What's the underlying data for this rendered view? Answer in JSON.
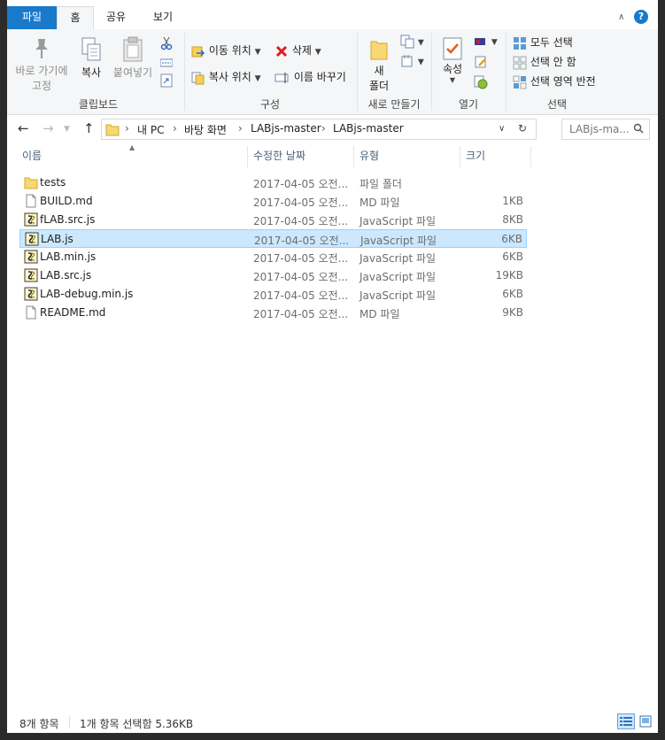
{
  "tabs": [
    {
      "label": "파일"
    },
    {
      "label": "홈"
    },
    {
      "label": "공유"
    },
    {
      "label": "보기"
    }
  ],
  "ribbon": {
    "clipboard": {
      "pin_label_1": "바로 가기에",
      "pin_label_2": "고정",
      "copy_label": "복사",
      "paste_label": "붙여넣기",
      "group_label": "클립보드"
    },
    "organize": {
      "move_label": "이동 위치",
      "copy_to_label": "복사 위치",
      "delete_label": "삭제",
      "rename_label": "이름 바꾸기",
      "group_label": "구성"
    },
    "new": {
      "new_folder_1": "새",
      "new_folder_2": "폴더",
      "group_label": "새로 만들기"
    },
    "open": {
      "properties_label": "속성",
      "group_label": "열기"
    },
    "select": {
      "select_all": "모두 선택",
      "select_none": "선택 안 함",
      "invert": "선택 영역 반전",
      "group_label": "선택"
    }
  },
  "address": {
    "crumbs": [
      "내 PC",
      "바탕 화면",
      "LABjs-master",
      "LABjs-master"
    ],
    "search_placeholder": "LABjs-ma..."
  },
  "columns": {
    "name": "이름",
    "date": "수정한 날짜",
    "type": "유형",
    "size": "크기"
  },
  "files": [
    {
      "name": "tests",
      "date": "2017-04-05 오전...",
      "type": "파일 폴더",
      "size": "",
      "icon": "folder-icon",
      "selected": false
    },
    {
      "name": "BUILD.md",
      "date": "2017-04-05 오전...",
      "type": "MD 파일",
      "size": "1KB",
      "icon": "document-icon",
      "selected": false
    },
    {
      "name": "fLAB.src.js",
      "date": "2017-04-05 오전...",
      "type": "JavaScript 파일",
      "size": "8KB",
      "icon": "script-icon",
      "selected": false
    },
    {
      "name": "LAB.js",
      "date": "2017-04-05 오전...",
      "type": "JavaScript 파일",
      "size": "6KB",
      "icon": "script-icon",
      "selected": true
    },
    {
      "name": "LAB.min.js",
      "date": "2017-04-05 오전...",
      "type": "JavaScript 파일",
      "size": "6KB",
      "icon": "script-icon",
      "selected": false
    },
    {
      "name": "LAB.src.js",
      "date": "2017-04-05 오전...",
      "type": "JavaScript 파일",
      "size": "19KB",
      "icon": "script-icon",
      "selected": false
    },
    {
      "name": "LAB-debug.min.js",
      "date": "2017-04-05 오전...",
      "type": "JavaScript 파일",
      "size": "6KB",
      "icon": "script-icon",
      "selected": false
    },
    {
      "name": "README.md",
      "date": "2017-04-05 오전...",
      "type": "MD 파일",
      "size": "9KB",
      "icon": "document-icon",
      "selected": false
    }
  ],
  "status": {
    "item_count": "8개 항목",
    "selection": "1개 항목 선택함 5.36KB"
  },
  "colors": {
    "accent": "#1979ca",
    "selection_bg": "#cce8ff",
    "selection_border": "#99d1ff"
  }
}
